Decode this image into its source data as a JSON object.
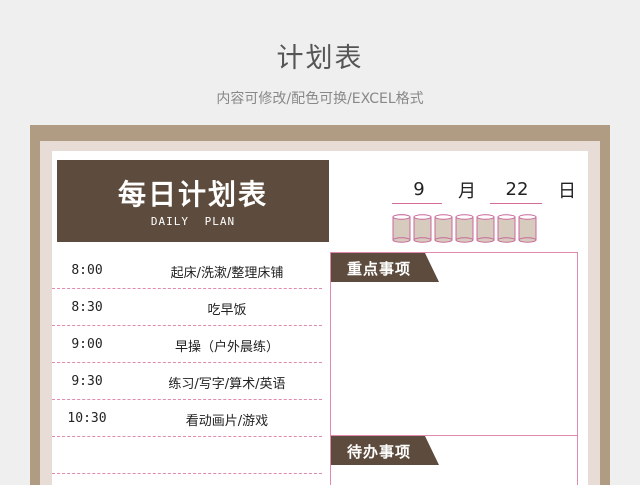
{
  "page": {
    "title": "计划表",
    "subtitle": "内容可修改/配色可换/EXCEL格式"
  },
  "header": {
    "title": "每日计划表",
    "subtitle": "DAILY PLAN"
  },
  "date": {
    "month": "9",
    "month_unit": "月",
    "day": "22",
    "day_unit": "日"
  },
  "schedule": [
    {
      "time": "8:00",
      "activity": "起床/洗漱/整理床铺"
    },
    {
      "time": "8:30",
      "activity": "吃早饭"
    },
    {
      "time": "9:00",
      "activity": "早操（户外晨练）"
    },
    {
      "time": "9:30",
      "activity": "练习/写字/算术/英语"
    },
    {
      "time": "10:30",
      "activity": "看动画片/游戏"
    },
    {
      "time": "",
      "activity": ""
    }
  ],
  "panels": {
    "priority": "重点事项",
    "todo": "待办事项"
  },
  "colors": {
    "brown": "#5d4c3d",
    "frame": "#b09c82",
    "pink": "#e08aae",
    "can_fill": "#d7cbbd"
  },
  "icons": {
    "can": "paper-cup-icon"
  }
}
